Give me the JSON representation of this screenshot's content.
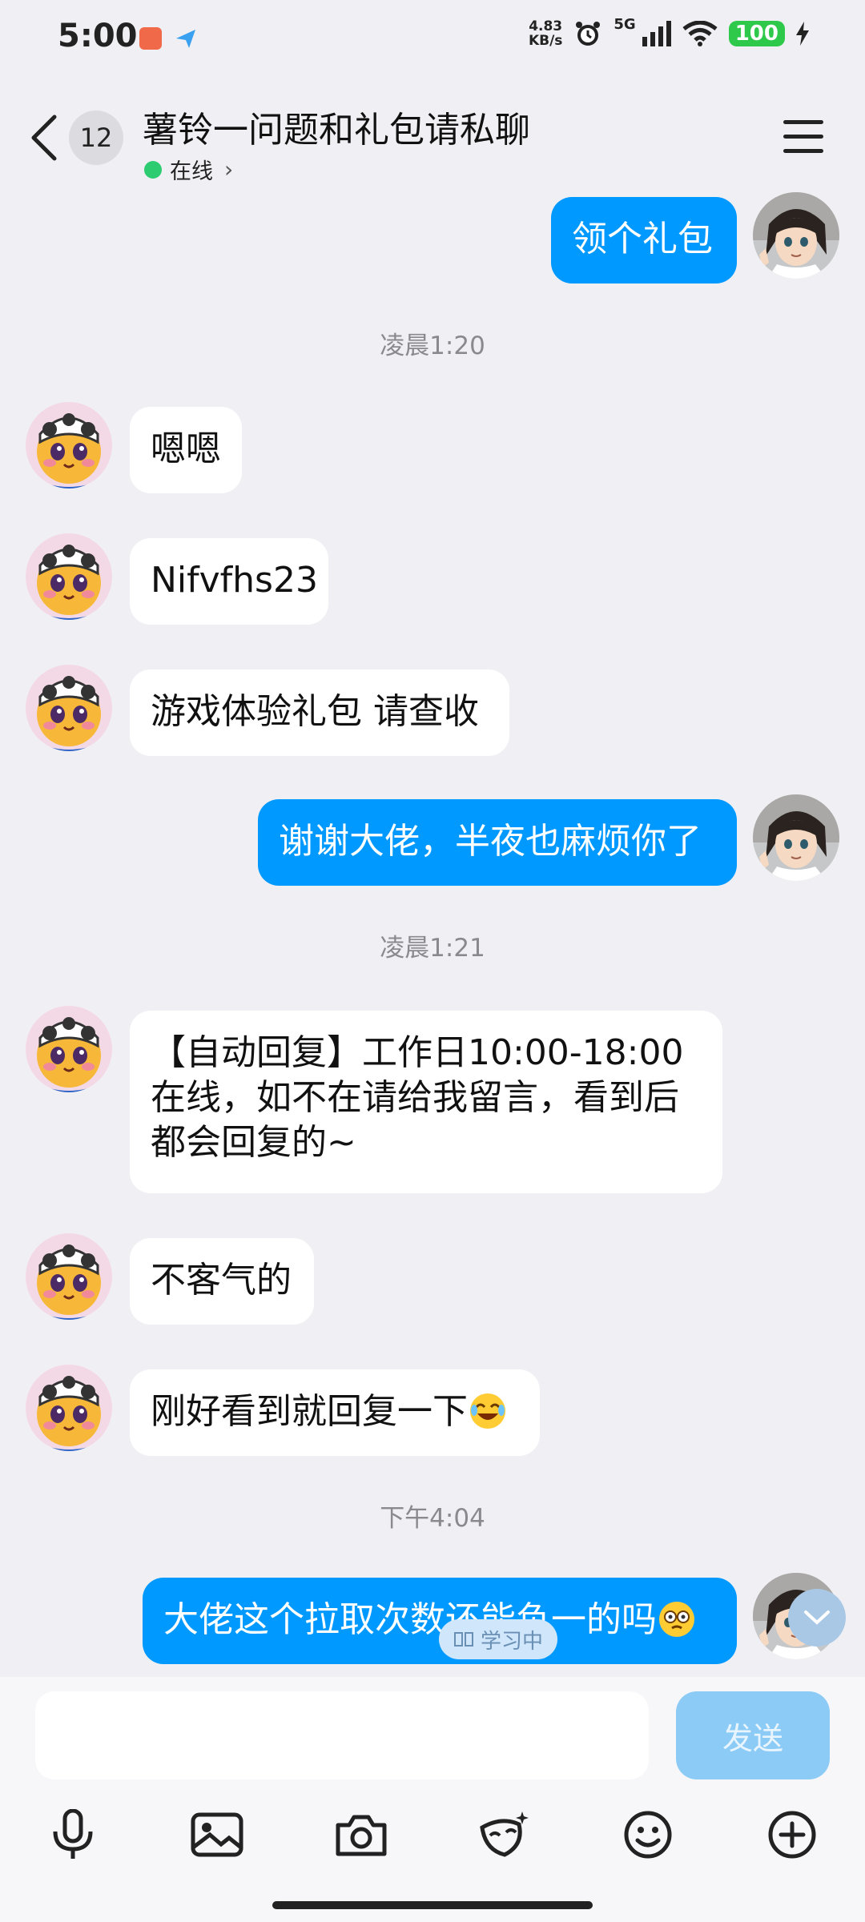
{
  "status_bar": {
    "time": "5:00",
    "net_speed_value": "4.83",
    "net_speed_unit": "KB/s",
    "network_type": "5G",
    "battery": "100"
  },
  "header": {
    "unread_count": "12",
    "title": "薯铃一问题和礼包请私聊",
    "status_text": "在线",
    "status_chevron": "›"
  },
  "messages": {
    "m1": "领个礼包",
    "t1": "凌晨1:20",
    "m2": "嗯嗯",
    "m3": "Nifvfhs23",
    "m4": "游戏体验礼包 请查收",
    "m5": "谢谢大佬，半夜也麻烦你了",
    "t2": "凌晨1:21",
    "m6": "【自动回复】工作日10:00-18:00在线，如不在请给我留言，看到后都会回复的~",
    "m7": "不客气的",
    "m8": "刚好看到就回复一下",
    "t3": "下午4:04",
    "m9": "大佬这个拉取次数还能负一的吗"
  },
  "overlay": {
    "learning_label": "学习中"
  },
  "composer": {
    "input_value": "",
    "send_label": "发送"
  },
  "icons": {
    "voice": "microphone-icon",
    "image": "image-icon",
    "camera": "camera-icon",
    "effects": "mask-sparkle-icon",
    "emoji": "smiley-icon",
    "more": "plus-icon"
  },
  "colors": {
    "accent": "#0099ff",
    "background": "#f0f0f4",
    "online": "#2ecc71",
    "send_disabled": "#8ccbf5"
  }
}
